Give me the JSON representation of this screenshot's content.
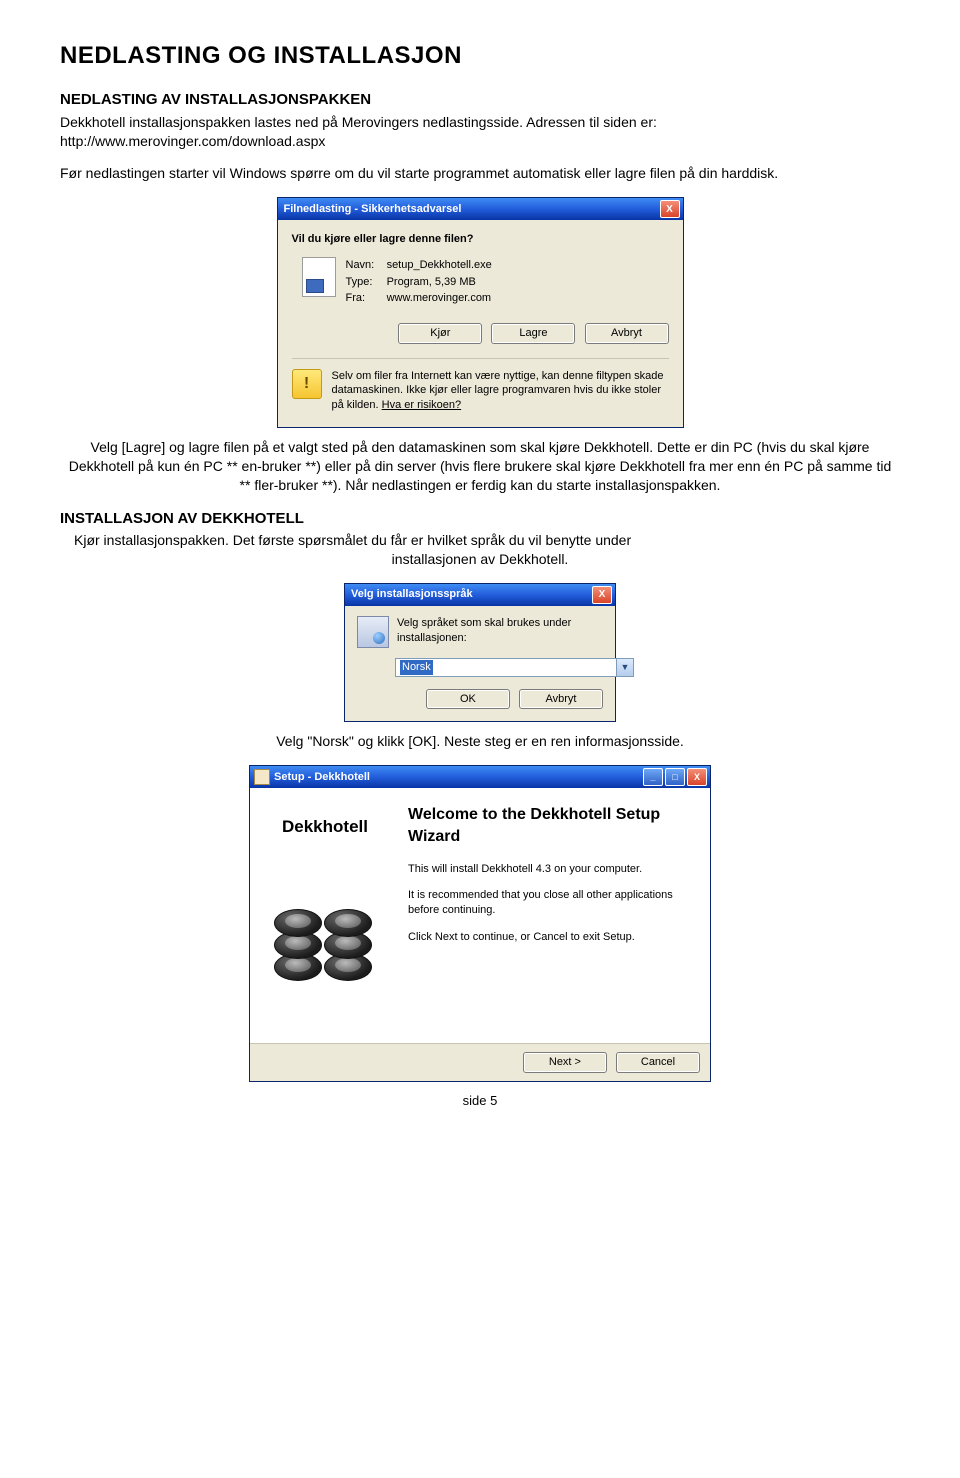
{
  "title": "NEDLASTING OG INSTALLASJON",
  "section1": {
    "heading": "NEDLASTING AV INSTALLASJONSPAKKEN",
    "p1": "Dekkhotell installasjonspakken lastes ned på Merovingers nedlastingsside. Adressen til siden er: http://www.merovinger.com/download.aspx",
    "p2": "Før nedlastingen starter vil Windows spørre om du vil starte programmet automatisk eller lagre filen på din harddisk."
  },
  "dl_dialog": {
    "title": "Filnedlasting - Sikkerhetsadvarsel",
    "question": "Vil du kjøre eller lagre denne filen?",
    "name_label": "Navn:",
    "name_value": "setup_Dekkhotell.exe",
    "type_label": "Type:",
    "type_value": "Program, 5,39 MB",
    "from_label": "Fra:",
    "from_value": "www.merovinger.com",
    "btn_run": "Kjør",
    "btn_save": "Lagre",
    "btn_cancel": "Avbryt",
    "warn_text": "Selv om filer fra Internett kan være nyttige, kan denne filtypen skade datamaskinen. Ikke kjør eller lagre programvaren hvis du ikke stoler på kilden. ",
    "warn_link": "Hva er risikoen?"
  },
  "middle": {
    "p1": "Velg [Lagre] og lagre filen på et valgt sted på den datamaskinen som skal kjøre Dekkhotell. Dette er din PC (hvis du skal kjøre Dekkhotell på kun én PC ** en-bruker **) eller på din server (hvis flere brukere skal kjøre Dekkhotell fra mer enn én PC på samme tid ** fler-bruker **). Når nedlastingen er ferdig kan du starte installasjonspakken."
  },
  "section2": {
    "heading": "INSTALLASJON AV DEKKHOTELL",
    "p1a": "Kjør installasjonspakken. Det første spørsmålet du får er hvilket språk du vil benytte under",
    "p1b": "installasjonen av Dekkhotell."
  },
  "lang_dialog": {
    "title": "Velg installasjonsspråk",
    "prompt": "Velg språket som skal brukes under installasjonen:",
    "selected": "Norsk",
    "btn_ok": "OK",
    "btn_cancel": "Avbryt"
  },
  "post_lang": "Velg \"Norsk\" og klikk [OK]. Neste steg er en ren informasjonsside.",
  "setup_dialog": {
    "title": "Setup - Dekkhotell",
    "brand": "Dekkhotell",
    "heading": "Welcome to the Dekkhotell Setup Wizard",
    "p1": "This will install Dekkhotell 4.3 on your computer.",
    "p2": "It is recommended that you close all other applications before continuing.",
    "p3": "Click Next to continue, or Cancel to exit Setup.",
    "btn_next": "Next >",
    "btn_cancel": "Cancel"
  },
  "footer": "side  5"
}
